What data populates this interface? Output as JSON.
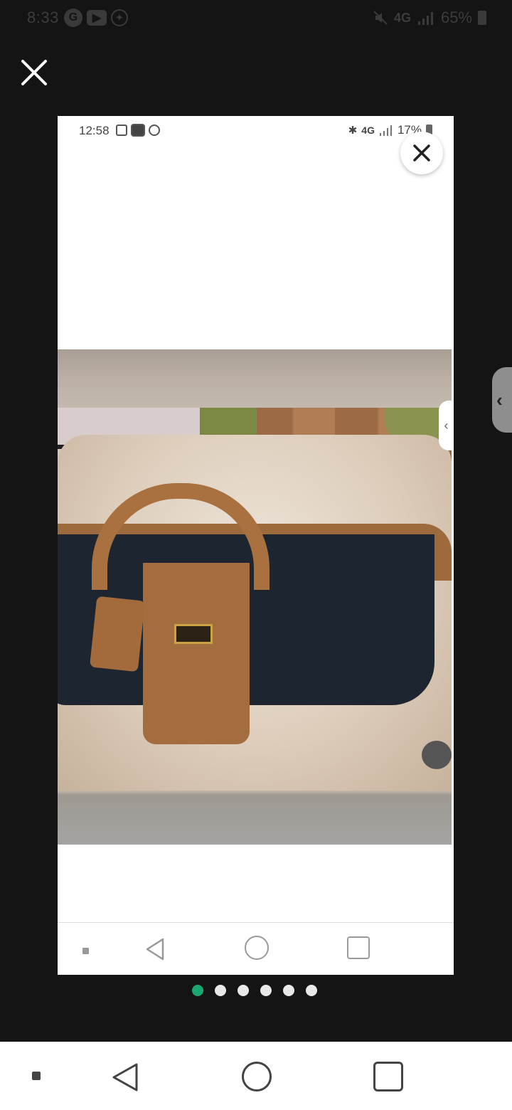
{
  "status_bar": {
    "time": "8:33",
    "icons": [
      "google-icon",
      "youtube-icon",
      "accessibility-icon"
    ],
    "network": "4G",
    "battery": "65%"
  },
  "viewer": {
    "close_icon": "close-icon",
    "current_page": 1,
    "total_pages": 6
  },
  "screenshot": {
    "status_bar": {
      "time": "12:58",
      "network": "4G",
      "battery": "17%"
    },
    "close_icon": "close-icon",
    "photo_description_icon": "photo",
    "chevron": "‹"
  },
  "side_tab": {
    "icon": "chevron-left-icon",
    "glyph": "‹"
  },
  "nav_bar": {
    "items": [
      "recents-dot",
      "back-icon",
      "home-icon",
      "overview-icon"
    ]
  },
  "colors": {
    "accent": "#1aa870",
    "background": "#141414"
  }
}
